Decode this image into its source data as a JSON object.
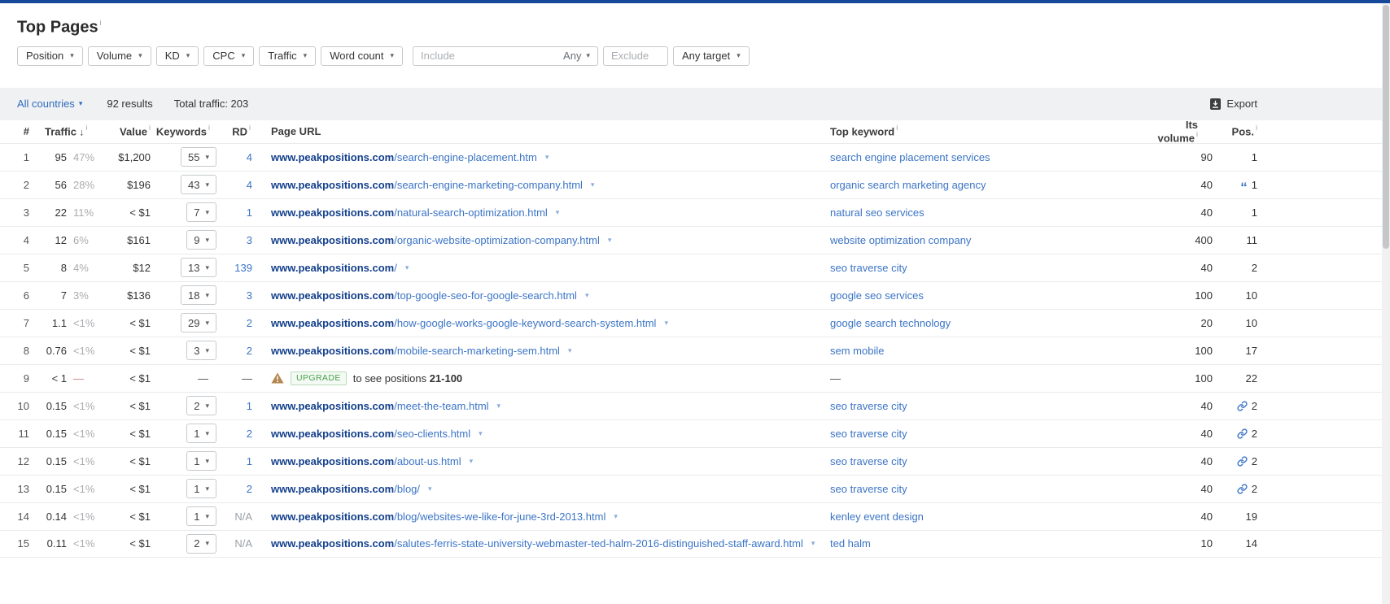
{
  "colors": {
    "topbar": "#17499a",
    "link_blue": "#3b74c5",
    "domain_blue": "#14408c",
    "upgrade_green": "#4aa04a",
    "warning_brown": "#b3874f",
    "toolbar_bg": "#f0f1f2"
  },
  "title": {
    "text": "Top Pages",
    "info_mark": "i"
  },
  "filters": {
    "dropdown_buttons": [
      "Position",
      "Volume",
      "KD",
      "CPC",
      "Traffic",
      "Word count"
    ],
    "include_input": {
      "placeholder": "Include",
      "mode_label": "Any"
    },
    "exclude_input": {
      "placeholder": "Exclude"
    },
    "target_button": "Any target",
    "caret_glyph": "▾"
  },
  "toolbar": {
    "countries_label": "All countries",
    "results_label": "92 results",
    "total_traffic_label": "Total traffic: 203",
    "export_label": "Export"
  },
  "table": {
    "headers": [
      {
        "label": "#",
        "info": false
      },
      {
        "label": "Traffic",
        "info": true,
        "sort": "↓"
      },
      {
        "label": "Value",
        "info": true
      },
      {
        "label": "Keywords",
        "info": true
      },
      {
        "label": "RD",
        "info": true
      },
      {
        "label": "Page URL",
        "info": false
      },
      {
        "label": "Top keyword",
        "info": true
      },
      {
        "label": "Its volume",
        "info": true
      },
      {
        "label": "Pos.",
        "info": true
      }
    ],
    "rows": [
      {
        "num": "1",
        "traffic": "95",
        "traffic_pct": "47%",
        "value": "$1,200",
        "keywords": "55",
        "rd": "4",
        "url_domain": "www.peakpositions.com",
        "url_path": "/search-engine-placement.htm",
        "top_keyword": "search engine placement services",
        "volume": "90",
        "pos": "1",
        "pos_icon": null
      },
      {
        "num": "2",
        "traffic": "56",
        "traffic_pct": "28%",
        "value": "$196",
        "keywords": "43",
        "rd": "4",
        "url_domain": "www.peakpositions.com",
        "url_path": "/search-engine-marketing-company.html",
        "top_keyword": "organic search marketing agency",
        "volume": "40",
        "pos": "1",
        "pos_icon": "quote"
      },
      {
        "num": "3",
        "traffic": "22",
        "traffic_pct": "11%",
        "value": "< $1",
        "keywords": "7",
        "rd": "1",
        "url_domain": "www.peakpositions.com",
        "url_path": "/natural-search-optimization.html",
        "top_keyword": "natural seo services",
        "volume": "40",
        "pos": "1",
        "pos_icon": null
      },
      {
        "num": "4",
        "traffic": "12",
        "traffic_pct": "6%",
        "value": "$161",
        "keywords": "9",
        "rd": "3",
        "url_domain": "www.peakpositions.com",
        "url_path": "/organic-website-optimization-company.html",
        "top_keyword": "website optimization company",
        "volume": "400",
        "pos": "11",
        "pos_icon": null
      },
      {
        "num": "5",
        "traffic": "8",
        "traffic_pct": "4%",
        "value": "$12",
        "keywords": "13",
        "rd": "139",
        "url_domain": "www.peakpositions.com",
        "url_path": "/",
        "top_keyword": "seo traverse city",
        "volume": "40",
        "pos": "2",
        "pos_icon": null
      },
      {
        "num": "6",
        "traffic": "7",
        "traffic_pct": "3%",
        "value": "$136",
        "keywords": "18",
        "rd": "3",
        "url_domain": "www.peakpositions.com",
        "url_path": "/top-google-seo-for-google-search.html",
        "top_keyword": "google seo services",
        "volume": "100",
        "pos": "10",
        "pos_icon": null
      },
      {
        "num": "7",
        "traffic": "1.1",
        "traffic_pct": "<1%",
        "value": "< $1",
        "keywords": "29",
        "rd": "2",
        "url_domain": "www.peakpositions.com",
        "url_path": "/how-google-works-google-keyword-search-system.html",
        "top_keyword": "google search technology",
        "volume": "20",
        "pos": "10",
        "pos_icon": null
      },
      {
        "num": "8",
        "traffic": "0.76",
        "traffic_pct": "<1%",
        "value": "< $1",
        "keywords": "3",
        "rd": "2",
        "url_domain": "www.peakpositions.com",
        "url_path": "/mobile-search-marketing-sem.html",
        "top_keyword": "sem mobile",
        "volume": "100",
        "pos": "17",
        "pos_icon": null
      },
      {
        "num": "9",
        "traffic": "< 1",
        "traffic_pct": "—",
        "value": "< $1",
        "keywords": "—",
        "rd": "—",
        "upgrade": {
          "badge_label": "UPGRADE",
          "text": "to see positions",
          "range": "21-100"
        },
        "top_keyword": "—",
        "volume": "100",
        "pos": "22",
        "pos_icon": null
      },
      {
        "num": "10",
        "traffic": "0.15",
        "traffic_pct": "<1%",
        "value": "< $1",
        "keywords": "2",
        "rd": "1",
        "url_domain": "www.peakpositions.com",
        "url_path": "/meet-the-team.html",
        "top_keyword": "seo traverse city",
        "volume": "40",
        "pos": "2",
        "pos_icon": "link"
      },
      {
        "num": "11",
        "traffic": "0.15",
        "traffic_pct": "<1%",
        "value": "< $1",
        "keywords": "1",
        "rd": "2",
        "url_domain": "www.peakpositions.com",
        "url_path": "/seo-clients.html",
        "top_keyword": "seo traverse city",
        "volume": "40",
        "pos": "2",
        "pos_icon": "link"
      },
      {
        "num": "12",
        "traffic": "0.15",
        "traffic_pct": "<1%",
        "value": "< $1",
        "keywords": "1",
        "rd": "1",
        "url_domain": "www.peakpositions.com",
        "url_path": "/about-us.html",
        "top_keyword": "seo traverse city",
        "volume": "40",
        "pos": "2",
        "pos_icon": "link"
      },
      {
        "num": "13",
        "traffic": "0.15",
        "traffic_pct": "<1%",
        "value": "< $1",
        "keywords": "1",
        "rd": "2",
        "url_domain": "www.peakpositions.com",
        "url_path": "/blog/",
        "top_keyword": "seo traverse city",
        "volume": "40",
        "pos": "2",
        "pos_icon": "link"
      },
      {
        "num": "14",
        "traffic": "0.14",
        "traffic_pct": "<1%",
        "value": "< $1",
        "keywords": "1",
        "rd": "N/A",
        "url_domain": "www.peakpositions.com",
        "url_path": "/blog/websites-we-like-for-june-3rd-2013.html",
        "top_keyword": "kenley event design",
        "volume": "40",
        "pos": "19",
        "pos_icon": null
      },
      {
        "num": "15",
        "traffic": "0.11",
        "traffic_pct": "<1%",
        "value": "< $1",
        "keywords": "2",
        "rd": "N/A",
        "url_domain": "www.peakpositions.com",
        "url_path": "/salutes-ferris-state-university-webmaster-ted-halm-2016-distinguished-staff-award.html",
        "top_keyword": "ted halm",
        "volume": "10",
        "pos": "14",
        "pos_icon": null
      }
    ]
  }
}
